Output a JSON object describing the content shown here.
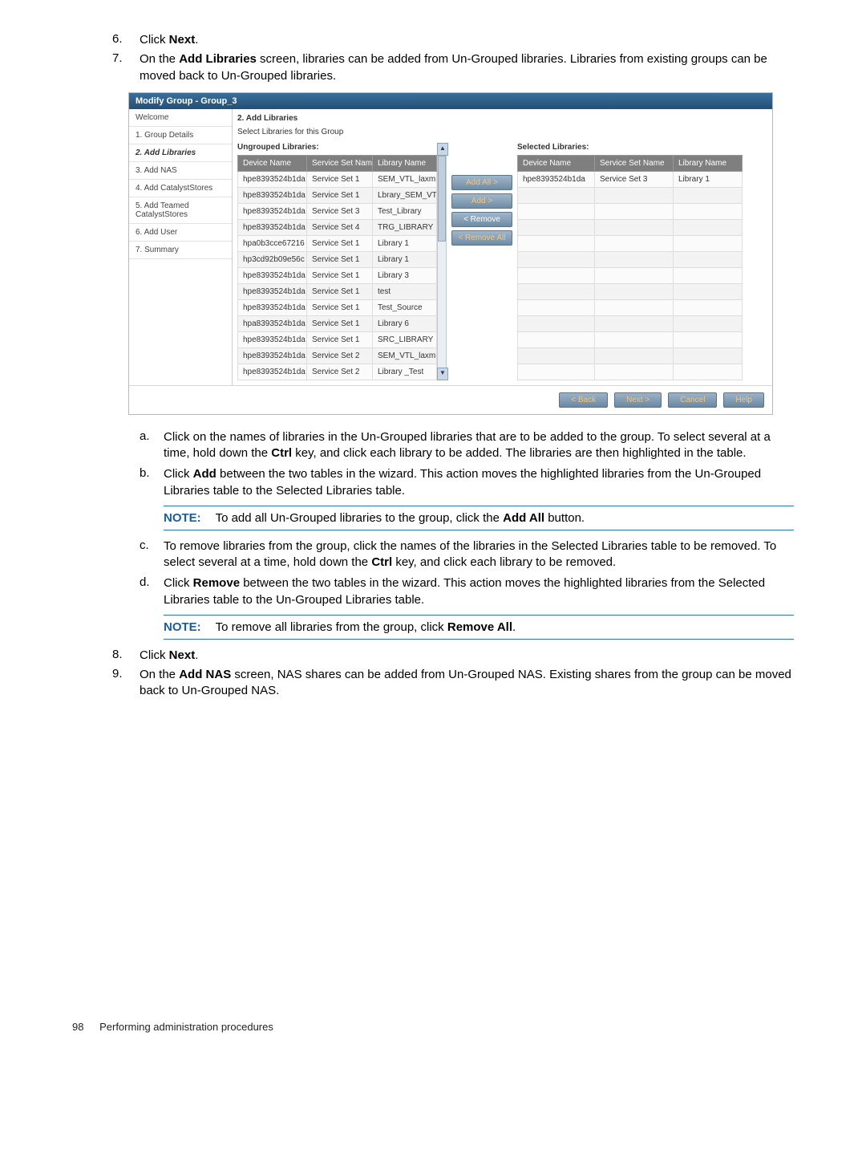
{
  "steps": {
    "s6_num": "6.",
    "s6_a": "Click ",
    "s6_b": "Next",
    "s6_c": ".",
    "s7_num": "7.",
    "s7_a": "On the ",
    "s7_b": "Add Libraries",
    "s7_c": " screen, libraries can be added from Un-Grouped libraries. Libraries from existing groups can be moved back to Un-Grouped libraries.",
    "s8_num": "8.",
    "s8_a": "Click ",
    "s8_b": "Next",
    "s8_c": ".",
    "s9_num": "9.",
    "s9_a": "On the ",
    "s9_b": "Add NAS",
    "s9_c": " screen, NAS shares can be added from Un-Grouped NAS. Existing shares from the group can be moved back to Un-Grouped NAS."
  },
  "sub": {
    "a_num": "a.",
    "a_1": "Click on the names of libraries in the Un-Grouped libraries that are to be added to the group. To select several at a time, hold down the ",
    "a_ctrl": "Ctrl",
    "a_2": " key, and click each library to be added. The libraries are then highlighted in the table.",
    "b_num": "b.",
    "b_1": "Click ",
    "b_add": "Add",
    "b_2": " between the two tables in the wizard. This action moves the highlighted libraries from the Un-Grouped Libraries table to the Selected Libraries table.",
    "c_num": "c.",
    "c_1": "To remove libraries from the group, click the names of the libraries in the Selected Libraries table to be removed. To select several at a time, hold down the ",
    "c_ctrl": "Ctrl",
    "c_2": " key, and click each library to be removed.",
    "d_num": "d.",
    "d_1": "Click ",
    "d_rem": "Remove",
    "d_2": " between the two tables in the wizard. This action moves the highlighted libraries from the Selected Libraries table to the Un-Grouped Libraries table."
  },
  "notes": {
    "label": "NOTE:",
    "n1_a": "To add all Un-Grouped libraries to the group, click the ",
    "n1_b": "Add All",
    "n1_c": " button.",
    "n2_a": "To remove all libraries from the group, click ",
    "n2_b": "Remove All",
    "n2_c": "."
  },
  "wizard": {
    "title": "Modify Group - Group_3",
    "nav": {
      "welcome": "Welcome",
      "s1": "1. Group Details",
      "s2": "2. Add Libraries",
      "s3": "3. Add NAS",
      "s4": "4. Add CatalystStores",
      "s5": "5. Add Teamed CatalystStores",
      "s6": "6. Add User",
      "s7": "7. Summary"
    },
    "step_title": "2. Add Libraries",
    "subtitle": "Select Libraries for this Group",
    "ungrouped_label": "Ungrouped Libraries:",
    "selected_label": "Selected Libraries:",
    "cols": {
      "device": "Device Name",
      "svc": "Service Set Name",
      "lib": "Library Name"
    },
    "ungrouped_rows": [
      {
        "d": "hpe8393524b1da",
        "s": "Service Set 1",
        "l": "SEM_VTL_laxmi"
      },
      {
        "d": "hpe8393524b1da",
        "s": "Service Set 1",
        "l": "Lbrary_SEM_VTL_La:"
      },
      {
        "d": "hpe8393524b1da",
        "s": "Service Set 3",
        "l": "Test_Library"
      },
      {
        "d": "hpe8393524b1da",
        "s": "Service Set 4",
        "l": "TRG_LIBRARY"
      },
      {
        "d": "hpa0b3cce67216",
        "s": "Service Set 1",
        "l": "Library 1"
      },
      {
        "d": "hp3cd92b09e56c",
        "s": "Service Set 1",
        "l": "Library 1"
      },
      {
        "d": "hpe8393524b1da",
        "s": "Service Set 1",
        "l": "Library 3"
      },
      {
        "d": "hpe8393524b1da",
        "s": "Service Set 1",
        "l": "test"
      },
      {
        "d": "hpe8393524b1da",
        "s": "Service Set 1",
        "l": "Test_Source"
      },
      {
        "d": "hpa8393524b1da",
        "s": "Service Set 1",
        "l": "Library 6"
      },
      {
        "d": "hpe8393524b1da",
        "s": "Service Set 1",
        "l": "SRC_LIBRARY"
      },
      {
        "d": "hpe8393524b1da",
        "s": "Service Set 2",
        "l": "SEM_VTL_laxmi_trg"
      },
      {
        "d": "hpe8393524b1da",
        "s": "Service Set 2",
        "l": "Library _Test"
      }
    ],
    "selected_rows": [
      {
        "d": "hpe8393524b1da",
        "s": "Service Set 3",
        "l": "Library 1"
      }
    ],
    "btns": {
      "add_all": "Add All >",
      "add": "Add >",
      "remove": "< Remove",
      "remove_all": "< Remove All"
    },
    "footer": {
      "back": "< Back",
      "next": "Next >",
      "cancel": "Cancel",
      "help": "Help"
    }
  },
  "footer": {
    "page": "98",
    "section": "Performing administration procedures"
  }
}
